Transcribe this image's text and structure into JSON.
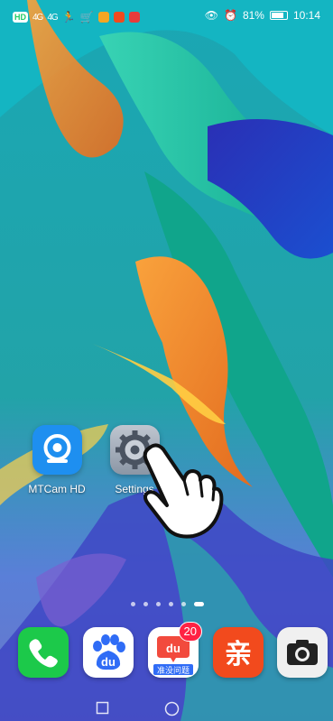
{
  "status_bar": {
    "network_badge": "HD",
    "signal_1": "4G",
    "signal_2": "4G",
    "battery_percent": "81%",
    "battery_level": 0.81,
    "time": "10:14"
  },
  "home": {
    "apps": [
      {
        "label": "MTCam HD",
        "icon": "camera-webcam-icon",
        "color": "#1e90ff"
      },
      {
        "label": "Settings",
        "icon": "gear-icon",
        "color": "#8e9aa8"
      }
    ]
  },
  "page_indicator": {
    "count": 6,
    "active_index": 5
  },
  "dock": {
    "apps": [
      {
        "name": "Phone",
        "icon": "phone-icon",
        "color": "#1cc94a"
      },
      {
        "name": "Baidu",
        "icon": "baidu-paw-icon",
        "color": "#2f6cf6",
        "text": "du"
      },
      {
        "name": "Baidu Zhidao",
        "icon": "baidu-zhidao-icon",
        "color": "#ffffff",
        "text": "du",
        "subtext": "准没问题",
        "badge": "20"
      },
      {
        "name": "Qin",
        "icon": "qin-icon",
        "color": "#f24a1d",
        "text": "亲"
      },
      {
        "name": "Camera",
        "icon": "camera-icon",
        "color": "#f0f0f0"
      }
    ]
  },
  "nav": {
    "back": "square-nav-icon",
    "home": "circle-nav-icon"
  }
}
